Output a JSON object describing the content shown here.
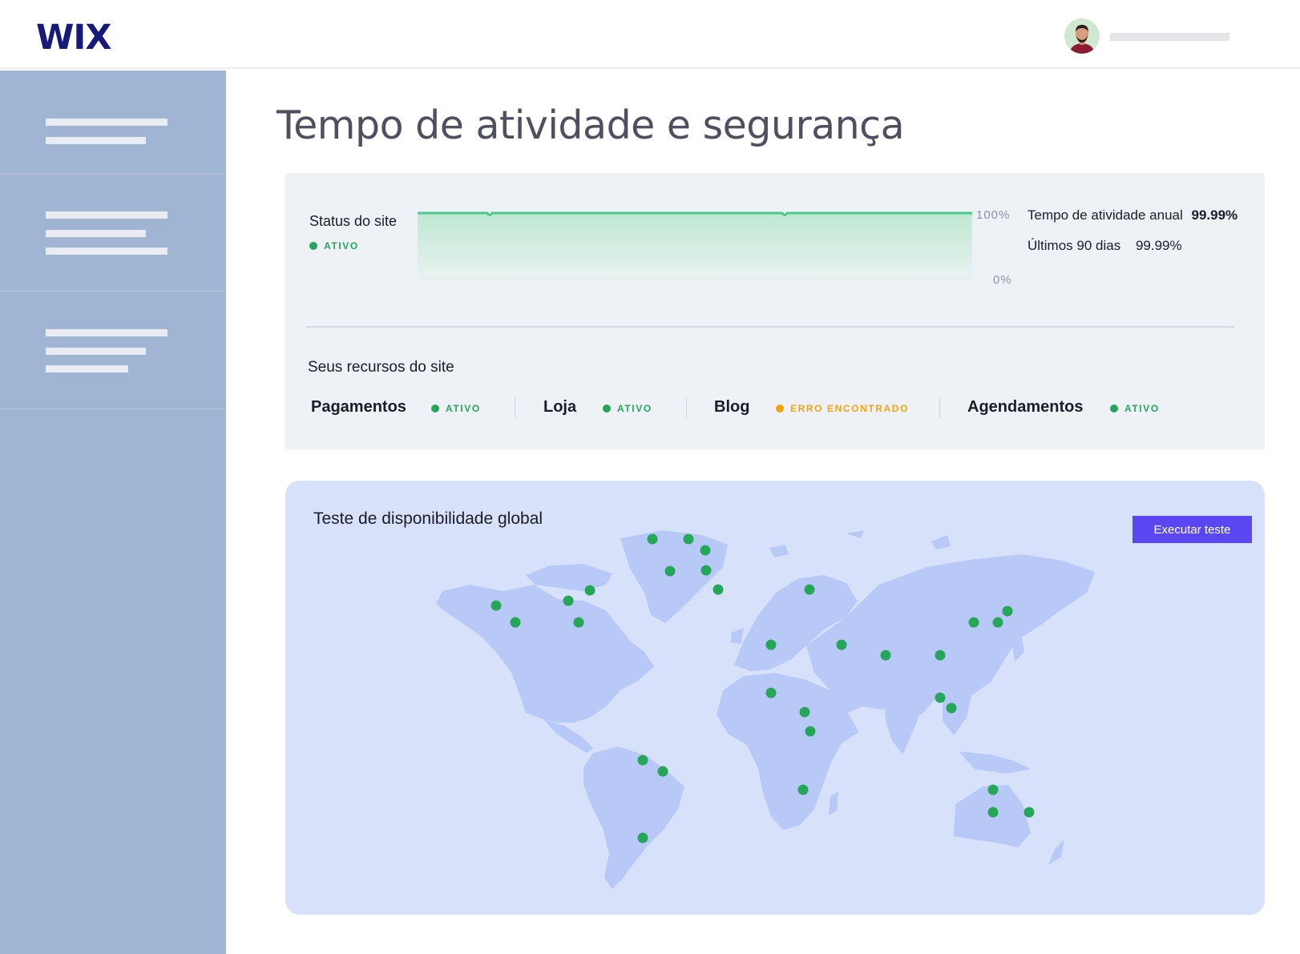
{
  "header": {
    "logo": "WIX"
  },
  "page": {
    "title": "Tempo de atividade e segurança"
  },
  "status": {
    "label": "Status do site",
    "badge": "ATIVO",
    "tick_max": "100%",
    "tick_min": "0%",
    "annual_label": "Tempo de atividade anual",
    "annual_value": "99.99%",
    "last90_label": "Últimos 90 dias",
    "last90_value": "99.99%",
    "uptime_level": 0.9999
  },
  "resources": {
    "label": "Seus recursos do site",
    "items": [
      {
        "name": "Pagamentos",
        "status": "ATIVO",
        "state": "ok"
      },
      {
        "name": "Loja",
        "status": "ATIVO",
        "state": "ok"
      },
      {
        "name": "Blog",
        "status": "ERRO ENCONTRADO",
        "state": "error"
      },
      {
        "name": "Agendamentos",
        "status": "ATIVO",
        "state": "ok"
      }
    ]
  },
  "global_test": {
    "title": "Teste de disponibilidade global",
    "button": "Executar teste"
  },
  "colors": {
    "brand": "#16187a",
    "accent": "#5b47f2",
    "active": "#25a659",
    "error": "#f5a30f",
    "sidebar": "#a0b4d3",
    "map_land": "#b8c9f7",
    "map_bg": "#d8e1fa"
  },
  "icons": {
    "avatar": "user-avatar",
    "status_dot": "status-dot-icon",
    "server_marker": "server-location-icon"
  }
}
